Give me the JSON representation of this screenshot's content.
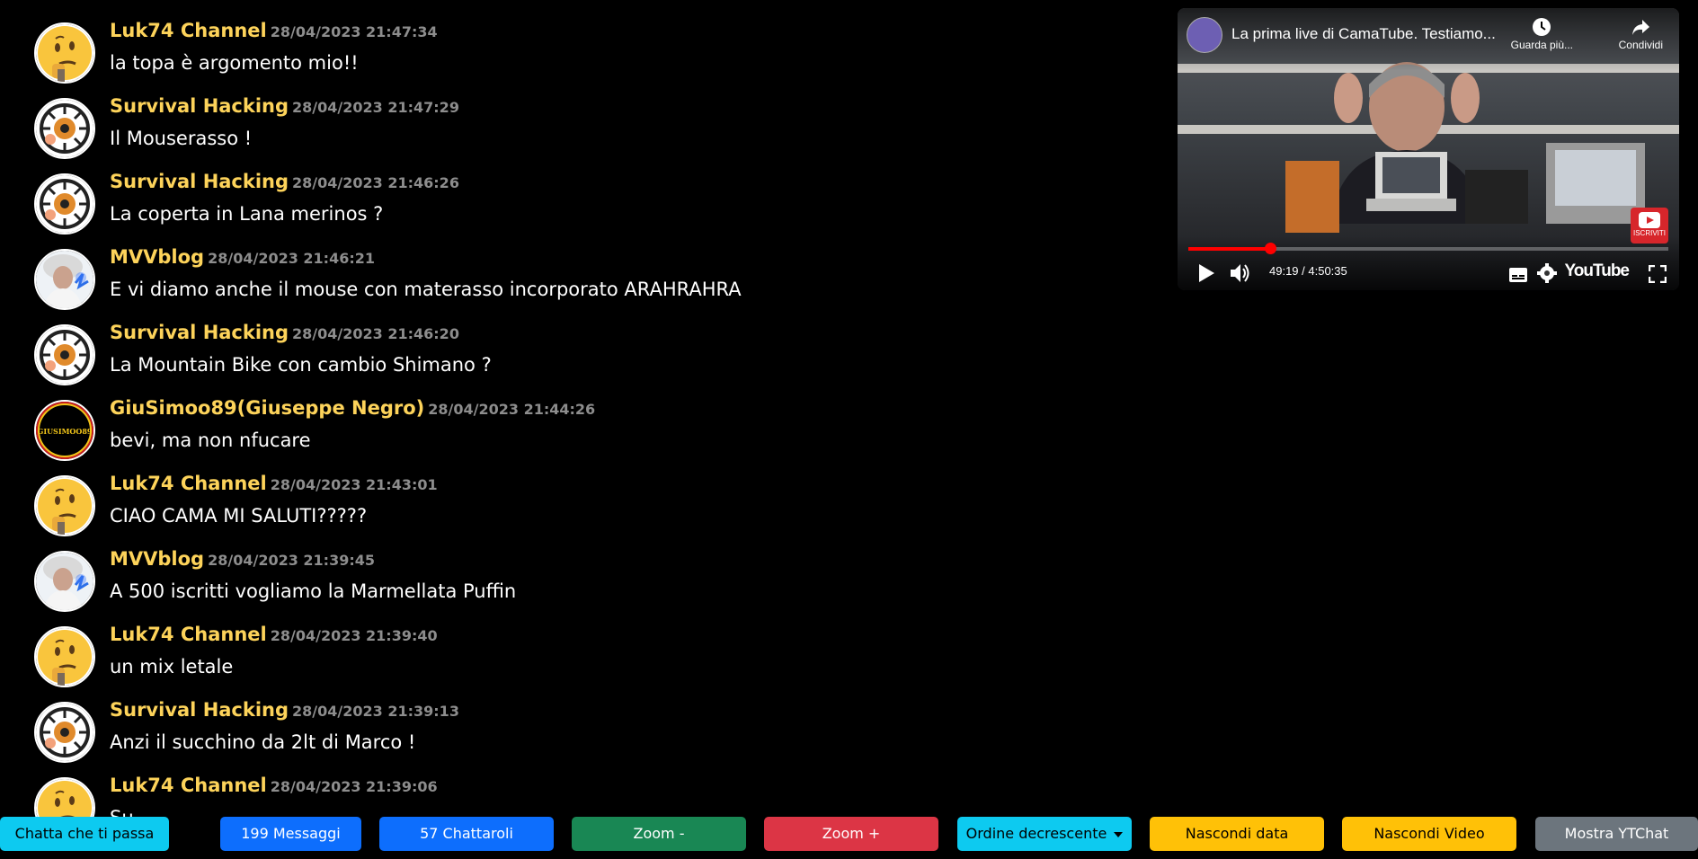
{
  "chat": {
    "messages": [
      {
        "author": "Luk74 Channel",
        "time": "28/04/2023 21:47:34",
        "text": "la topa è argomento mio!!",
        "avatar": "thinking-emoji-avatar"
      },
      {
        "author": "Survival Hacking",
        "time": "28/04/2023 21:47:29",
        "text": "Il Mouserasso !",
        "avatar": "survival-hacking-avatar"
      },
      {
        "author": "Survival Hacking",
        "time": "28/04/2023 21:46:26",
        "text": "La coperta in Lana merinos ?",
        "avatar": "survival-hacking-avatar"
      },
      {
        "author": "MVVblog",
        "time": "28/04/2023 21:46:21",
        "text": "E vi diamo anche il mouse con materasso incorporato ARAHRAHRA",
        "avatar": "mvvblog-avatar"
      },
      {
        "author": "Survival Hacking",
        "time": "28/04/2023 21:46:20",
        "text": "La Mountain Bike con cambio Shimano ?",
        "avatar": "survival-hacking-avatar"
      },
      {
        "author": "GiuSimoo89(Giuseppe Negro)",
        "time": "28/04/2023 21:44:26",
        "text": "bevi, ma non nfucare",
        "avatar": "giusimoo-avatar"
      },
      {
        "author": "Luk74 Channel",
        "time": "28/04/2023 21:43:01",
        "text": "CIAO CAMA MI SALUTI?????",
        "avatar": "thinking-emoji-avatar"
      },
      {
        "author": "MVVblog",
        "time": "28/04/2023 21:39:45",
        "text": "A 500 iscritti vogliamo la Marmellata Puffin",
        "avatar": "mvvblog-avatar"
      },
      {
        "author": "Luk74 Channel",
        "time": "28/04/2023 21:39:40",
        "text": "un mix letale",
        "avatar": "thinking-emoji-avatar"
      },
      {
        "author": "Survival Hacking",
        "time": "28/04/2023 21:39:13",
        "text": "Anzi il succhino da 2lt di Marco !",
        "avatar": "survival-hacking-avatar"
      },
      {
        "author": "Luk74 Channel",
        "time": "28/04/2023 21:39:06",
        "text": "Su",
        "avatar": "thinking-emoji-avatar"
      }
    ],
    "avatar_text": {
      "giusimoo": "GIUSIMOO89"
    }
  },
  "video": {
    "title": "La prima live di CamaTube. Testiamo...",
    "watch_later_label": "Guarda più...",
    "share_label": "Condividi",
    "subscribe_label": "ISCRIVITI",
    "time": "49:19 / 4:50:35",
    "progress": 0.17,
    "logo": "YouTube",
    "icons": [
      "clock-icon",
      "share-icon",
      "play-icon",
      "volume-icon",
      "subtitles-icon",
      "gear-icon",
      "fullscreen-icon"
    ]
  },
  "toolbar": {
    "buttons": [
      {
        "label": "Chatta che ti passa",
        "color": "#0dcaf0",
        "text_color": "#000000"
      },
      {
        "label": "199 Messaggi",
        "color": "#0d6efd",
        "text_color": "#ffffff"
      },
      {
        "label": "57 Chattaroli",
        "color": "#0d6efd",
        "text_color": "#ffffff"
      },
      {
        "label": "Zoom -",
        "color": "#198754",
        "text_color": "#ffffff"
      },
      {
        "label": "Zoom +",
        "color": "#dc3545",
        "text_color": "#ffffff"
      },
      {
        "label": "Ordine decrescente",
        "color": "#0dcaf0",
        "text_color": "#000000"
      },
      {
        "label": "Nascondi data",
        "color": "#ffc107",
        "text_color": "#000000"
      },
      {
        "label": "Nascondi Video",
        "color": "#ffc107",
        "text_color": "#000000"
      },
      {
        "label": "Mostra YTChat",
        "color": "#6c757d",
        "text_color": "#ffffff"
      }
    ]
  },
  "colors": {
    "author": "#fdd35a",
    "timestamp": "#8d8d8d",
    "background": "#000000"
  }
}
